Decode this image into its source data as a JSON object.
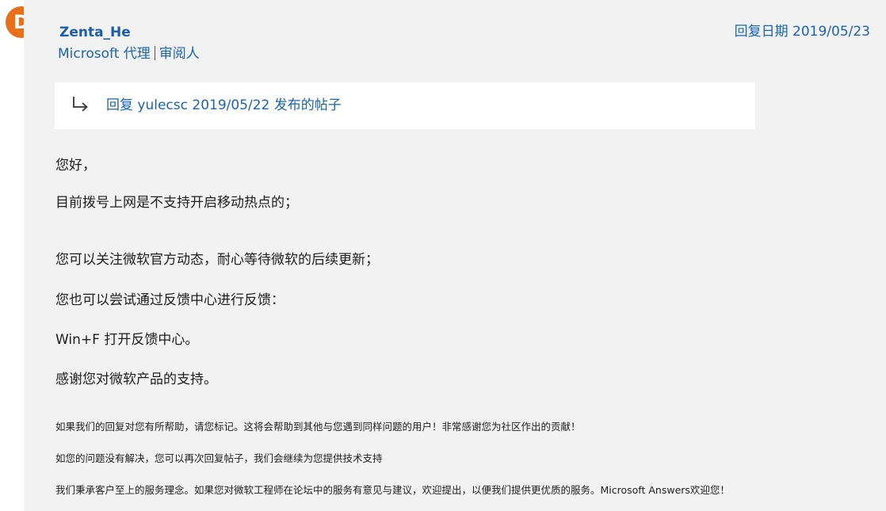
{
  "author": {
    "avatar_letter": "D",
    "name": "Zenta_He",
    "org": "Microsoft 代理",
    "role": "审阅人"
  },
  "reply_date": "回复日期 2019/05/23",
  "reply_to": {
    "icon": "reply-arrow-icon",
    "text": "回复 yulecsc 2019/05/22 发布的帖子"
  },
  "body": {
    "lines": [
      "您好，",
      "目前拨号上网是不支持开启移动热点的；",
      "您可以关注微软官方动态，耐心等待微软的后续更新；",
      "您也可以尝试通过反馈中心进行反馈：",
      "Win+F 打开反馈中心。",
      "感谢您对微软产品的支持。"
    ]
  },
  "footer": {
    "lines": [
      "如果我们的回复对您有所帮助，请您标记。这将会帮助到其他与您遇到同样问题的用户！非常感谢您为社区作出的贡献！",
      "如您的问题没有解决，您可以再次回复帖子，我们会继续为您提供技术支持",
      "我们秉承客户至上的服务理念。如果您对微软工程师在论坛中的服务有意见与建议，欢迎提出，以便我们提供更优质的服务。Microsoft Answers欢迎您！"
    ]
  },
  "colors": {
    "avatar": "#e8701a",
    "link": "#1a64b3",
    "panel_bg": "#f2f2f2"
  }
}
